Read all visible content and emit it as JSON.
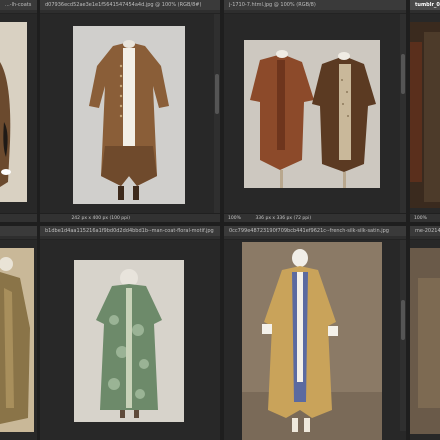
{
  "windows": [
    {
      "tab": "...-lh-coats",
      "zoom": ""
    },
    {
      "tab": "d07936ecd52ae3e1e1f5641547454a4d.jpg @ 100% (RGB/8#)",
      "zoom": "",
      "dims": "242 px x 400 px (100 ppi)"
    },
    {
      "tab": "j-1710-7.html.jpg @ 100% (RGB/8)",
      "zoom": "100%",
      "dims": "336 px x 336 px (72 ppi)"
    },
    {
      "tab": "tumblr_0...",
      "zoom": "100%"
    },
    {
      "tab": "",
      "zoom": ""
    },
    {
      "tab": "b1dbe1d4aa115216a1f9bd0d2dd4bbd1b--man-coat-floral-motif.jpg",
      "zoom": ""
    },
    {
      "tab": "0cc799e48723190f709bcb441ef9621c--french-silk-silk-satin.jpg",
      "zoom": ""
    },
    {
      "tab": "me-20214...",
      "zoom": ""
    }
  ],
  "icons": {
    "photo_left_top": "coat-photo-icon",
    "photo_center_top": "brown-coat-photo",
    "photo_right_top": "two-coats-photo"
  }
}
